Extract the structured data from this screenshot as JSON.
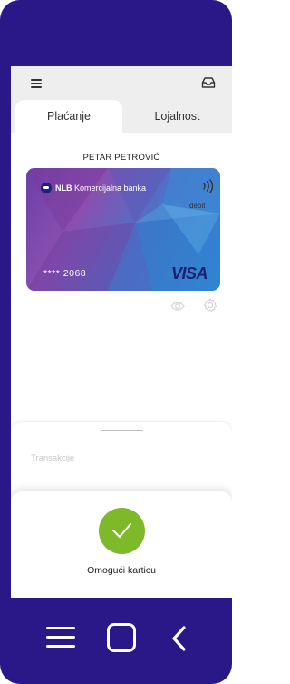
{
  "header": {
    "menu_icon": "hamburger-menu-icon",
    "inbox_icon": "inbox-icon"
  },
  "tabs": [
    {
      "label": "Plaćanje",
      "active": true
    },
    {
      "label": "Lojalnost",
      "active": false
    }
  ],
  "card": {
    "holder_name": "PETAR PETROVIĆ",
    "bank_name_bold": "NLB",
    "bank_name_rest": " Komercijalna banka",
    "type": "debit",
    "masked_number": "**** 2068",
    "network": "VISA"
  },
  "sheet": {
    "transactions_label": "Transakcije"
  },
  "enable_card": {
    "label": "Omogući karticu",
    "color": "#7db928"
  },
  "colors": {
    "frame": "#2a1788",
    "header_bg": "#eeeeee",
    "accent_green": "#7db928"
  }
}
